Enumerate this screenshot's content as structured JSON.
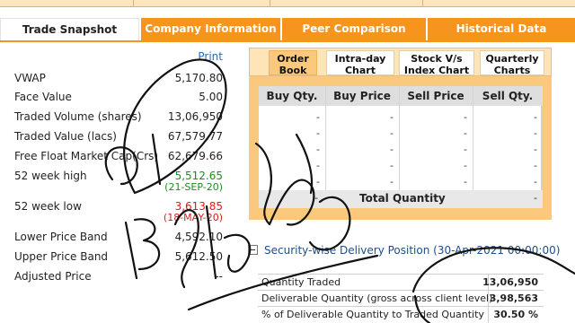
{
  "tabs": [
    {
      "label": "Trade Snapshot",
      "active": true
    },
    {
      "label": "Company Information",
      "active": false
    },
    {
      "label": "Peer Comparison",
      "active": false
    },
    {
      "label": "Historical Data",
      "active": false
    }
  ],
  "snapshot": {
    "print_label": "Print",
    "rows": [
      {
        "label": "VWAP",
        "value": "5,170.80"
      },
      {
        "label": "Face Value",
        "value": "5.00"
      },
      {
        "label": "Traded Volume (shares)",
        "value": "13,06,950"
      },
      {
        "label": "Traded Value (lacs)",
        "value": "67,579.77"
      },
      {
        "label": "Free Float Market Cap(Crs)",
        "value": "62,679.66"
      },
      {
        "label": "52 week high",
        "value": "5,512.65",
        "date": "(21-SEP-20)"
      },
      {
        "label": "52 week low",
        "value": "3,613.85",
        "date": "(18-MAY-20)"
      },
      {
        "label": "Lower Price Band",
        "value": "4,592.10"
      },
      {
        "label": "Upper Price Band",
        "value": "5,612.50"
      },
      {
        "label": "Adjusted Price",
        "value": "--"
      }
    ]
  },
  "sub_tabs": [
    {
      "label": "Order Book",
      "active": true
    },
    {
      "label": "Intra-day Chart",
      "active": false
    },
    {
      "label": "Stock V/s Index Chart",
      "active": false
    },
    {
      "label": "Quarterly Charts",
      "active": false
    }
  ],
  "order_book": {
    "headers": [
      "Buy Qty.",
      "Buy Price",
      "Sell Price",
      "Sell Qty."
    ],
    "rows": [
      [
        "-",
        "-",
        "-",
        "-"
      ],
      [
        "-",
        "-",
        "-",
        "-"
      ],
      [
        "-",
        "-",
        "-",
        "-"
      ],
      [
        "-",
        "-",
        "-",
        "-"
      ],
      [
        "-",
        "-",
        "-",
        "-"
      ]
    ],
    "total_label": "Total Quantity",
    "total_left": "-",
    "total_right": "-"
  },
  "delivery": {
    "title": "Security-wise Delivery Position (30-Apr-2021 00:00:00)",
    "rows": [
      {
        "label": "Quantity Traded",
        "value": "13,06,950"
      },
      {
        "label": "Deliverable Quantity (gross across client level)",
        "value": "3,98,563"
      },
      {
        "label": "% of Deliverable Quantity to Traded Quantity",
        "value": "30.50 %"
      }
    ]
  },
  "colors": {
    "accent": "#f7941d",
    "subtab_active": "#fbc97c",
    "green": "#1f8a1f",
    "red": "#d22020",
    "link": "#2a6ab7"
  }
}
